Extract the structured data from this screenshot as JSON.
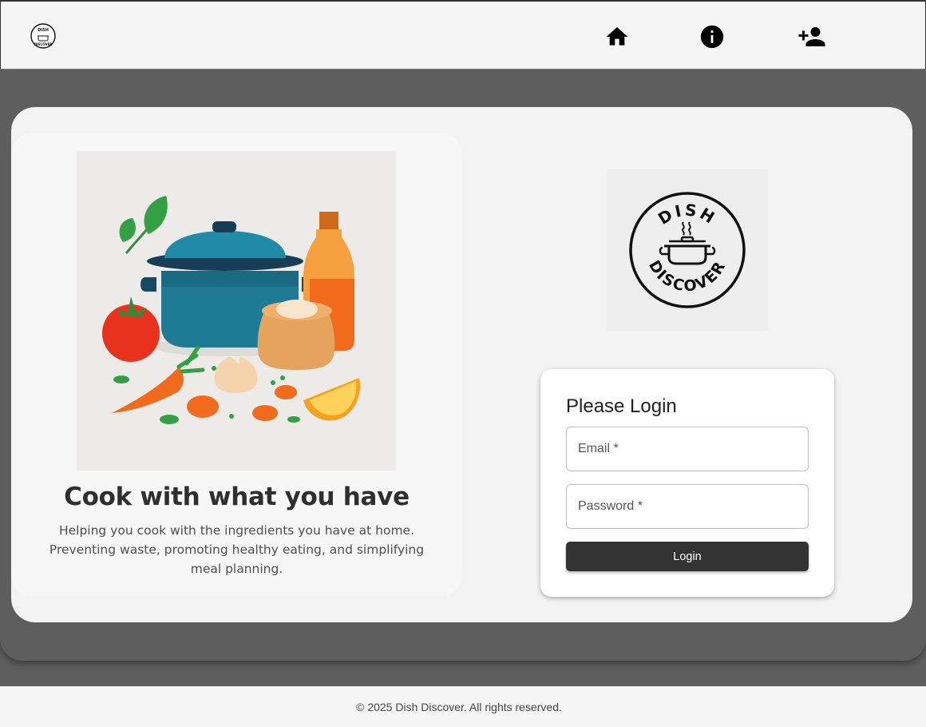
{
  "header": {
    "brand_logo": "dish-discover-logo",
    "nav": [
      {
        "id": "home",
        "icon": "home-icon"
      },
      {
        "id": "about",
        "icon": "info-icon"
      },
      {
        "id": "register",
        "icon": "person-add-icon"
      }
    ]
  },
  "hero": {
    "image": "cooking-ingredients-illustration",
    "title": "Cook with what you have",
    "text": "Helping you cook with the ingredients you have at home. Preventing waste, promoting healthy eating, and simplifying meal planning."
  },
  "logo": {
    "top_text": "DISH",
    "bottom_text": "DISCOVER"
  },
  "login": {
    "title": "Please Login",
    "email_label": "Email *",
    "password_label": "Password *",
    "submit_label": "Login"
  },
  "footer": {
    "text": "© 2025 Dish Discover. All rights reserved."
  },
  "colors": {
    "page_bg": "#5e5e5e",
    "header_bg": "#f5f5f5",
    "card_bg": "#f3f3f3",
    "button_bg": "#333333",
    "pot_teal": "#1f7a96",
    "carrot_orange": "#f26b1d"
  }
}
